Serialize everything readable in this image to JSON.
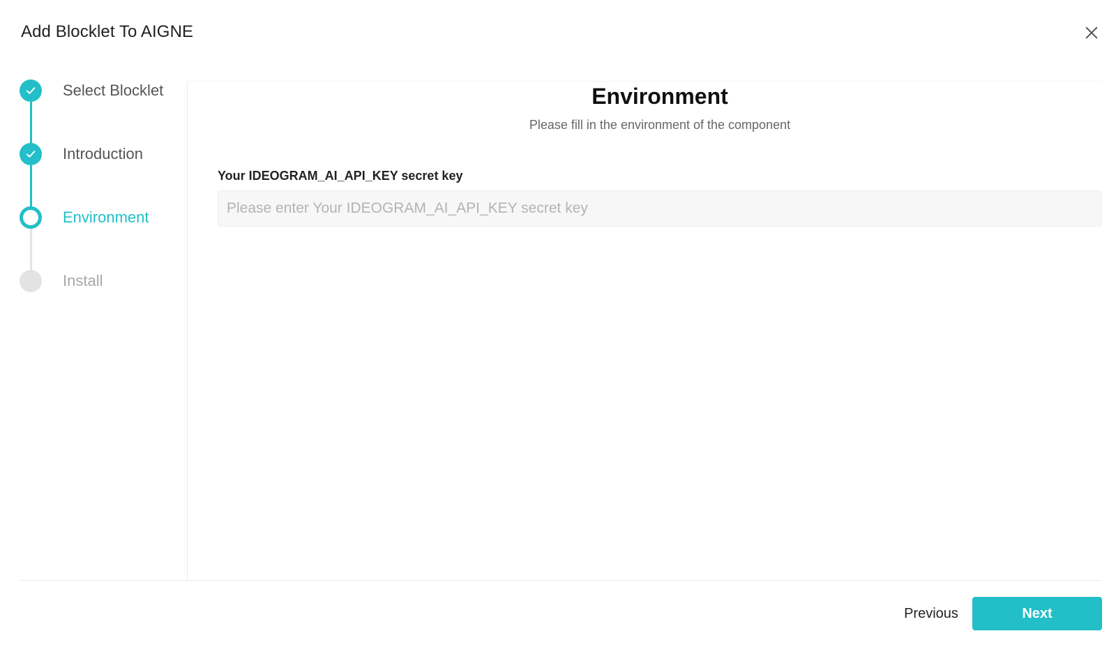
{
  "dialog": {
    "title": "Add Blocklet To AIGNE",
    "close_icon": "close-icon"
  },
  "stepper": {
    "steps": [
      {
        "label": "Select Blocklet",
        "status": "completed",
        "icon": "check-icon"
      },
      {
        "label": "Introduction",
        "status": "completed",
        "icon": "check-icon"
      },
      {
        "label": "Environment",
        "status": "active",
        "icon": "ring"
      },
      {
        "label": "Install",
        "status": "pending",
        "icon": "dot"
      }
    ]
  },
  "main": {
    "title": "Environment",
    "subtitle": "Please fill in the environment of the component",
    "field": {
      "label": "Your IDEOGRAM_AI_API_KEY secret key",
      "value": "",
      "placeholder": "Please enter Your IDEOGRAM_AI_API_KEY secret key"
    }
  },
  "footer": {
    "previous_label": "Previous",
    "next_label": "Next"
  },
  "colors": {
    "accent": "#22bfc8",
    "pending": "#e3e3e3",
    "text": "#222222",
    "muted": "#a8a8a8"
  }
}
